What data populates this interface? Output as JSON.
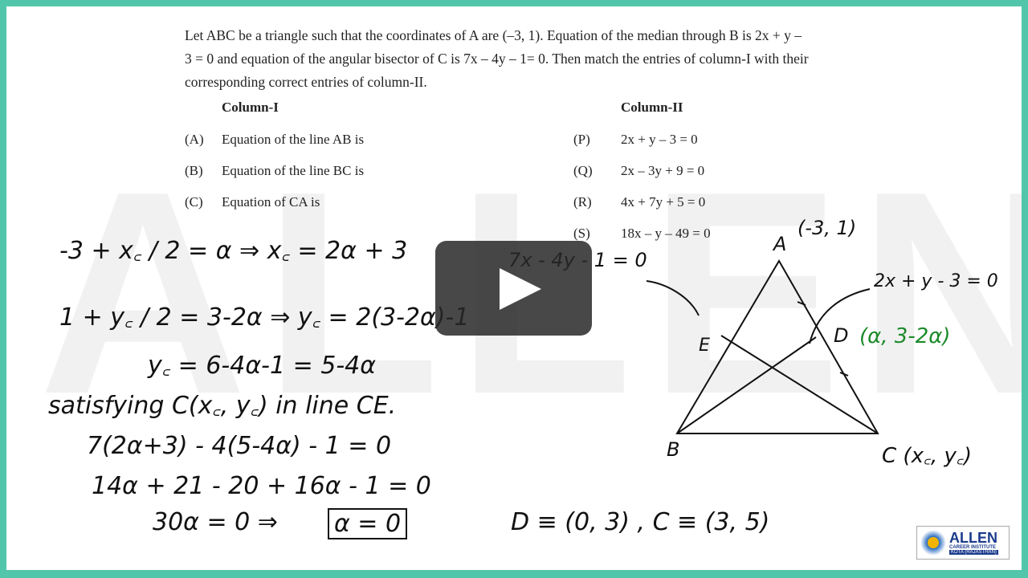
{
  "watermark": "ALLEN",
  "question": "Let ABC be a triangle such that the coordinates of A are (–3, 1). Equation of the median through B is 2x + y – 3 = 0 and equation of the angular bisector of C is 7x – 4y – 1= 0. Then match the entries of column-I with their corresponding correct entries of column-II.",
  "column1": {
    "header": "Column-I",
    "items": [
      {
        "key": "(A)",
        "text": "Equation of the line AB is"
      },
      {
        "key": "(B)",
        "text": "Equation of the line BC is"
      },
      {
        "key": "(C)",
        "text": "Equation of CA is"
      }
    ]
  },
  "column2": {
    "header": "Column-II",
    "items": [
      {
        "key": "(P)",
        "text": "2x + y – 3 = 0"
      },
      {
        "key": "(Q)",
        "text": "2x – 3y + 9 = 0"
      },
      {
        "key": "(R)",
        "text": "4x + 7y + 5 = 0"
      },
      {
        "key": "(S)",
        "text": "18x – y – 49 = 0"
      }
    ]
  },
  "handwriting": {
    "l1": "-3 + x꜀ / 2 = α ⇒ x꜀ = 2α + 3",
    "l2": "1 + y꜀ / 2 = 3-2α ⇒ y꜀ = 2(3-2α)-1",
    "l3": "y꜀ = 6-4α-1 = 5-4α",
    "l4": "satisfying C(x꜀, y꜀) in line CE.",
    "l5": "7(2α+3) - 4(5-4α) - 1 = 0",
    "l6": "14α + 21 - 20 + 16α - 1 = 0",
    "l7a": "30α = 0 ⇒",
    "l7b": "α = 0",
    "l8": "D ≡ (0, 3) ,  C ≡ (3, 5)"
  },
  "diagram": {
    "A": "A",
    "B": "B",
    "C": "C (x꜀, y꜀)",
    "E": "E",
    "D": "D",
    "Acoord": "(-3, 1)",
    "Dcoord": "(α, 3-2α)",
    "median": "2x + y - 3 = 0",
    "bisector": "7x - 4y - 1 = 0"
  },
  "logo": {
    "name": "ALLEN",
    "line2": "CAREER INSTITUTE",
    "line3": "KOTA (RAJASTHAN)"
  },
  "colors": {
    "border": "#52c6ab",
    "green_ink": "#1b8a2a"
  },
  "play_icon": "play-icon"
}
